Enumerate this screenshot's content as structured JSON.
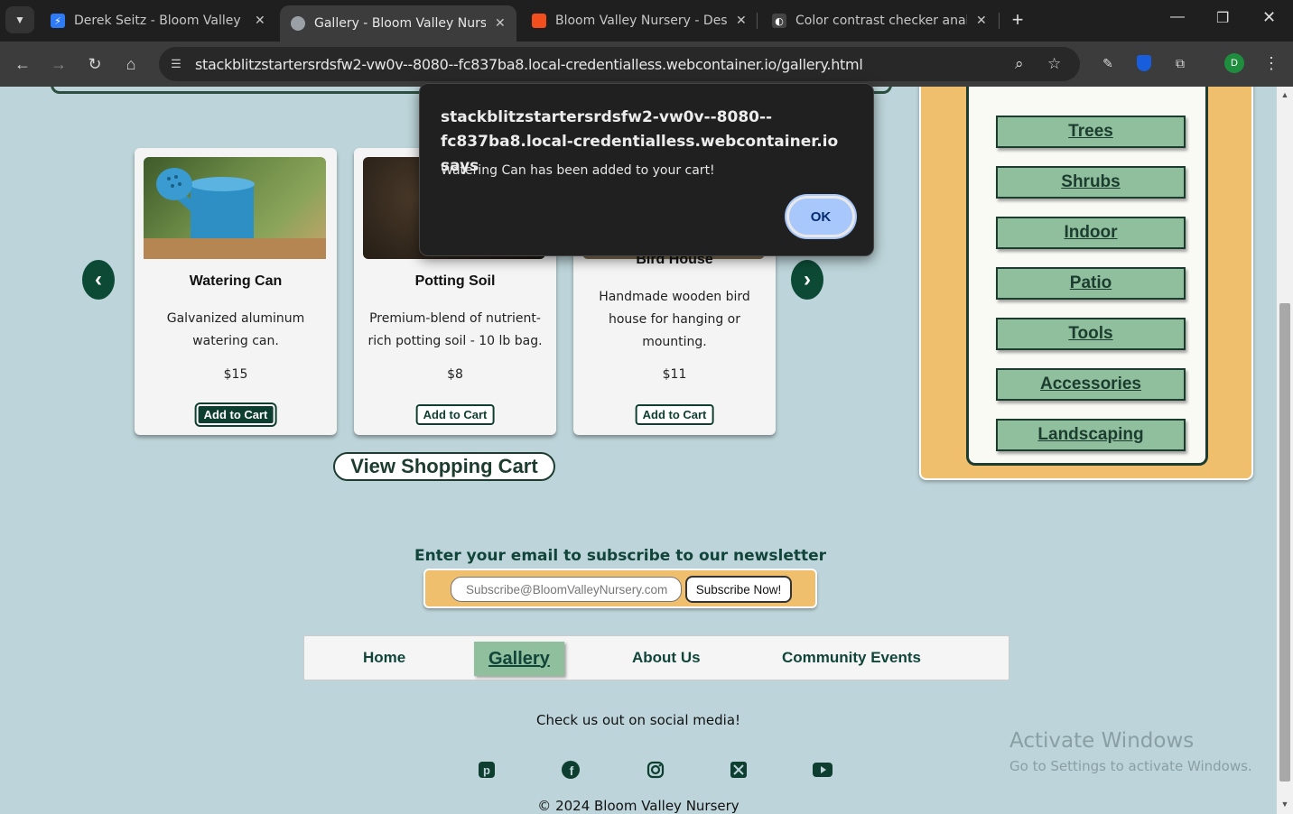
{
  "browser": {
    "tabs": [
      {
        "title": "Derek Seitz - Bloom Valley Nurs",
        "favicon_color": "#2f7bf6"
      },
      {
        "title": "Gallery - Bloom Valley Nursery",
        "favicon_color": "#9aa0a6"
      },
      {
        "title": "Bloom Valley Nursery - Desktop",
        "favicon_color": "#f24e1e"
      },
      {
        "title": "Color contrast checker analyzer",
        "favicon_color": "#444444"
      }
    ],
    "url": "stackblitzstartersrdsfw2-vw0v--8080--fc837ba8.local-credentialless.webcontainer.io/gallery.html",
    "profile_initial": "D"
  },
  "products": [
    {
      "name": "Watering Can",
      "description": "Galvanized aluminum watering can.",
      "price": "$15",
      "button": "Add to Cart"
    },
    {
      "name": "Potting Soil",
      "description": "Premium-blend of nutrient-rich potting soil - 10 lb bag.",
      "price": "$8",
      "button": "Add to Cart"
    },
    {
      "name": "Bird House",
      "description": "Handmade wooden bird house for hanging or mounting.",
      "price": "$11",
      "button": "Add to Cart"
    }
  ],
  "view_cart_label": "View Shopping Cart",
  "categories": [
    "Trees",
    "Shrubs",
    "Indoor",
    "Patio",
    "Tools",
    "Accessories",
    "Landscaping"
  ],
  "newsletter": {
    "title": "Enter your email to subscribe to our newsletter",
    "placeholder": "Subscribe@BloomValleyNursery.com",
    "button": "Subscribe Now!"
  },
  "footer_nav": [
    "Home",
    "Gallery",
    "About Us",
    "Community Events"
  ],
  "social_text": "Check us out on social media!",
  "copyright": "© 2024 Bloom Valley Nursery",
  "watermark": {
    "line1": "Activate Windows",
    "line2": "Go to Settings to activate Windows."
  },
  "dialog": {
    "title": "stackblitzstartersrdsfw2-vw0v--8080--fc837ba8.local-credentialless.webcontainer.io says",
    "message": "Watering Can has been added to your cart!",
    "ok": "OK"
  },
  "colors": {
    "accent_green": "#0d4a36",
    "category_green": "#8fbf9d",
    "sidebar_gold": "#f0bf6e",
    "page_bg": "#bdd5da"
  }
}
